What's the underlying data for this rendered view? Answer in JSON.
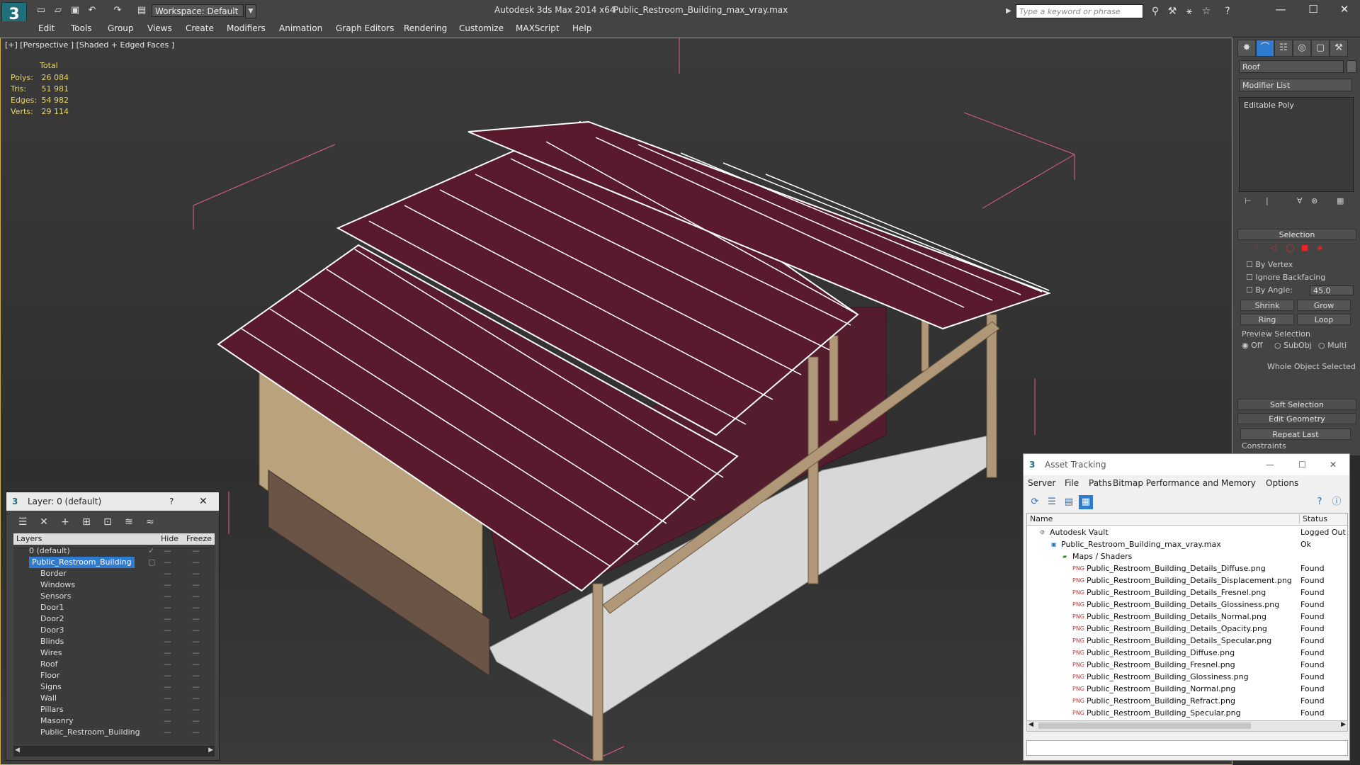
{
  "titlebar": {
    "workspace": "Workspace: Default",
    "app_title": "Autodesk 3ds Max  2014 x64",
    "file_name": "Public_Restroom_Building_max_vray.max",
    "search_placeholder": "Type a keyword or phrase"
  },
  "menu": [
    "Edit",
    "Tools",
    "Group",
    "Views",
    "Create",
    "Modifiers",
    "Animation",
    "Graph Editors",
    "Rendering",
    "Customize",
    "MAXScript",
    "Help"
  ],
  "viewport": {
    "label": "[+] [Perspective ] [Shaded + Edged Faces ]",
    "stats_header": "Total",
    "stats": [
      {
        "label": "Polys:",
        "value": "26 084"
      },
      {
        "label": "Tris:",
        "value": "51 981"
      },
      {
        "label": "Edges:",
        "value": "54 982"
      },
      {
        "label": "Verts:",
        "value": "29 114"
      }
    ]
  },
  "command_panel": {
    "object_name": "Roof",
    "modifier_list": "Modifier List",
    "stack_item": "Editable Poly",
    "selection_title": "Selection",
    "by_vertex": "By Vertex",
    "ignore_backfacing": "Ignore Backfacing",
    "by_angle": "By Angle:",
    "angle_value": "45.0",
    "shrink": "Shrink",
    "grow": "Grow",
    "ring": "Ring",
    "loop": "Loop",
    "preview_selection": "Preview Selection",
    "off": "Off",
    "subobj": "SubObj",
    "multi": "Multi",
    "whole_object": "Whole Object Selected",
    "soft_selection": "Soft Selection",
    "edit_geometry": "Edit Geometry",
    "repeat_last": "Repeat Last",
    "constraints": "Constraints"
  },
  "layer_window": {
    "title": "Layer: 0 (default)",
    "help": "?",
    "col_layers": "Layers",
    "col_hide": "Hide",
    "col_freeze": "Freeze",
    "rows": [
      {
        "name": "0 (default)"
      },
      {
        "name": "Public_Restroom_Building"
      },
      {
        "name": "Border"
      },
      {
        "name": "Windows"
      },
      {
        "name": "Sensors"
      },
      {
        "name": "Door1"
      },
      {
        "name": "Door2"
      },
      {
        "name": "Door3"
      },
      {
        "name": "Blinds"
      },
      {
        "name": "Wires"
      },
      {
        "name": "Roof"
      },
      {
        "name": "Floor"
      },
      {
        "name": "Signs"
      },
      {
        "name": "Wall"
      },
      {
        "name": "Pillars"
      },
      {
        "name": "Masonry"
      },
      {
        "name": "Public_Restroom_Building"
      }
    ]
  },
  "asset_window": {
    "title": "Asset Tracking",
    "menu": [
      "Server",
      "File",
      "Paths",
      "Bitmap Performance and Memory",
      "Options"
    ],
    "col_name": "Name",
    "col_status": "Status",
    "rows": [
      {
        "name": "Autodesk Vault",
        "status": "Logged Out"
      },
      {
        "name": "Public_Restroom_Building_max_vray.max",
        "status": "Ok"
      },
      {
        "name": "Maps / Shaders",
        "status": ""
      },
      {
        "name": "Public_Restroom_Building_Details_Diffuse.png",
        "status": "Found"
      },
      {
        "name": "Public_Restroom_Building_Details_Displacement.png",
        "status": "Found"
      },
      {
        "name": "Public_Restroom_Building_Details_Fresnel.png",
        "status": "Found"
      },
      {
        "name": "Public_Restroom_Building_Details_Glossiness.png",
        "status": "Found"
      },
      {
        "name": "Public_Restroom_Building_Details_Normal.png",
        "status": "Found"
      },
      {
        "name": "Public_Restroom_Building_Details_Opacity.png",
        "status": "Found"
      },
      {
        "name": "Public_Restroom_Building_Details_Specular.png",
        "status": "Found"
      },
      {
        "name": "Public_Restroom_Building_Diffuse.png",
        "status": "Found"
      },
      {
        "name": "Public_Restroom_Building_Fresnel.png",
        "status": "Found"
      },
      {
        "name": "Public_Restroom_Building_Glossiness.png",
        "status": "Found"
      },
      {
        "name": "Public_Restroom_Building_Normal.png",
        "status": "Found"
      },
      {
        "name": "Public_Restroom_Building_Refract.png",
        "status": "Found"
      },
      {
        "name": "Public_Restroom_Building_Specular.png",
        "status": "Found"
      }
    ]
  },
  "colors": {
    "roof": "#5a1a2e",
    "wall": "#b9a27c",
    "masonry": "#6a5446",
    "floor": "#d8d8d8",
    "selection": "#2f7bd0",
    "viewport_border": "#d4b04a"
  }
}
